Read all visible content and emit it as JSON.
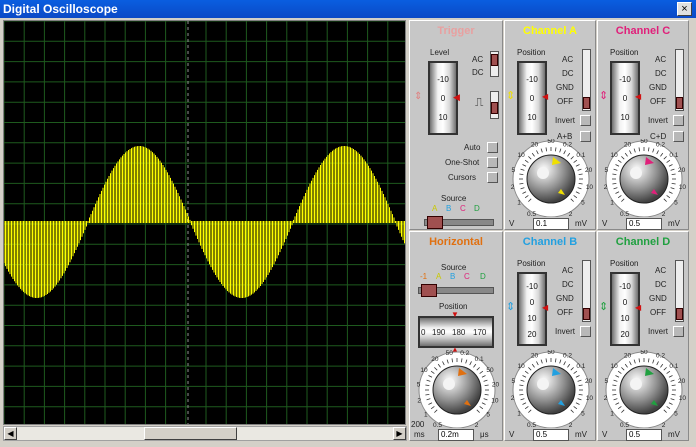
{
  "window": {
    "title": "Digital Oscilloscope",
    "close_glyph": "×"
  },
  "trigger": {
    "title": "Trigger",
    "level_label": "Level",
    "coupling": [
      "AC",
      "DC"
    ],
    "drum_values": [
      "-10",
      "0",
      "10"
    ],
    "modes": [
      "Auto",
      "One-Shot",
      "Cursors"
    ],
    "source_label": "Source",
    "source_channels": [
      "A",
      "B",
      "C",
      "D"
    ]
  },
  "channel_a": {
    "title": "Channel A",
    "position_label": "Position",
    "coupling": [
      "AC",
      "DC",
      "GND",
      "OFF"
    ],
    "drum_values": [
      "-10",
      "0",
      "10"
    ],
    "invert_label": "Invert",
    "combine_label": "A+B",
    "scale_ticks": [
      "0.2",
      "0.5",
      "1",
      "2",
      "5",
      "10",
      "20",
      "50",
      "0.1",
      "2",
      "5",
      "10",
      "20"
    ],
    "unit_left": "V",
    "value": "0.1",
    "unit_right": "mV"
  },
  "channel_b": {
    "title": "Channel B",
    "position_label": "Position",
    "coupling": [
      "AC",
      "DC",
      "GND",
      "OFF"
    ],
    "drum_values": [
      "-10",
      "0",
      "10",
      "20"
    ],
    "invert_label": "Invert",
    "unit_left": "V",
    "value": "0.5",
    "unit_right": "mV"
  },
  "channel_c": {
    "title": "Channel C",
    "position_label": "Position",
    "coupling": [
      "AC",
      "DC",
      "GND",
      "OFF"
    ],
    "drum_values": [
      "-10",
      "0",
      "10"
    ],
    "invert_label": "Invert",
    "combine_label": "C+D",
    "unit_left": "V",
    "value": "0.5",
    "unit_right": "mV"
  },
  "channel_d": {
    "title": "Channel D",
    "position_label": "Position",
    "coupling": [
      "AC",
      "DC",
      "GND",
      "OFF"
    ],
    "drum_values": [
      "-10",
      "0",
      "10",
      "20"
    ],
    "invert_label": "Invert",
    "unit_left": "V",
    "value": "0.5",
    "unit_right": "mV"
  },
  "horizontal": {
    "title": "Horizontal",
    "source_label": "Source",
    "source_channels": [
      "-1",
      "A",
      "B",
      "C",
      "D"
    ],
    "position_label": "Position",
    "position_values": [
      "0",
      "190",
      "180",
      "170"
    ],
    "unit_left": "ms",
    "value": "0.2m",
    "unit_right": "μs",
    "min_label": "200"
  },
  "colors": {
    "trace": "#ffff00",
    "grid": "#1e5a1e",
    "trigger_title": "#e8a0a0",
    "channel_a": "#ffff00",
    "channel_b": "#22a0e0",
    "channel_c": "#e0207a",
    "channel_d": "#20a040",
    "horizontal": "#e07010"
  },
  "knob_tick_labels": [
    "0.5",
    "1",
    "2",
    "5",
    "10",
    "20",
    "50",
    "0.2",
    "0.1",
    "20",
    "10",
    "5",
    "2"
  ],
  "horizontal_tick_labels": [
    "0.5",
    "1",
    "2",
    "5",
    "10",
    "20",
    "50",
    "0.2",
    "0.1",
    "50",
    "20",
    "10",
    "5",
    "2"
  ]
}
